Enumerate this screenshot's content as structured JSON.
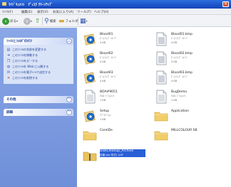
{
  "window": {
    "title": "ﾏｲﾄﾞｷｭﾒﾝﾄ　ﾃﾞｨｽｸ ｸﾘｰﾝｱｯﾌﾟ",
    "close_glyph": "✕"
  },
  "menubar": [
    "ﾌｧｲﾙ(F)",
    "編集(E)",
    "表示(V)",
    "お気に入り(A)",
    "ツール(T)",
    "ヘルプ(H)"
  ],
  "toolbar": {
    "back_label": "戻る",
    "search_label": "検索",
    "folders_label": "フォルダ"
  },
  "left_pane": {
    "tasks_title": "ﾌｧｲﾙとﾌｫﾙﾀﾞのﾀｽｸ",
    "tasks": [
      "このﾌｧｲﾙの名前を変更する",
      "このﾌｧｲﾙを移動する",
      "このﾌｧｲﾙをｺﾋﾟｰする",
      "このﾌｧｲﾙを Web に公開する",
      "このﾌｧｲﾙを電子ﾒｰﾙで送信する",
      "このﾌｧｲﾙを削除する"
    ],
    "other_title": "その他",
    "details_title": "詳細",
    "toggle_glyph": "︽",
    "expand_glyph": "︾"
  },
  "files": [
    {
      "name": "Blood01",
      "desc": "ﾋﾞｯﾄﾏｯﾌﾟ ｲﾒｰｼﾞ",
      "size": "4 KB",
      "icon": "image-file-icon"
    },
    {
      "name": "Blood01.bmp",
      "desc": "ﾋﾞｯﾄﾏｯﾌﾟ ｲﾒｰｼﾞ",
      "size": "4 KB",
      "icon": "bitmap-file-icon"
    },
    {
      "name": "Blood02",
      "desc": "ﾋﾞｯﾄﾏｯﾌﾟ ｲﾒｰｼﾞ",
      "size": "4 KB",
      "icon": "image-file-icon"
    },
    {
      "name": "Blood02.bmp",
      "desc": "ﾋﾞｯﾄﾏｯﾌﾟ ｲﾒｰｼﾞ",
      "size": "4 KB",
      "icon": "bitmap-file-icon"
    },
    {
      "name": "Blood03",
      "desc": "ﾋﾞｯﾄﾏｯﾌﾟ ｲﾒｰｼﾞ",
      "size": "4 KB",
      "icon": "image-file-icon"
    },
    {
      "name": "Blood03.bmp",
      "desc": "ﾋﾞｯﾄﾏｯﾌﾟ ｲﾒｰｼﾞ",
      "size": "4 KB",
      "icon": "bitmap-file-icon"
    },
    {
      "name": "BOA#9051",
      "desc": "ﾃｷｽﾄ ﾄﾞｷｭﾒﾝﾄ",
      "size": "1 KB",
      "icon": "text-file-icon"
    },
    {
      "name": "BugDemo",
      "desc": "ﾃｷｽﾄ ﾄﾞｷｭﾒﾝﾄ",
      "size": "1 KB",
      "icon": "text-file-icon"
    },
    {
      "name": "Setup",
      "desc": "ｱﾌﾟﾘｹｰｼｮﾝ",
      "size": "1 KB",
      "icon": "image-file-icon"
    },
    {
      "name": "Application",
      "desc": "",
      "size": "",
      "icon": "folder-icon"
    },
    {
      "name": "CorelDe",
      "desc": "",
      "size": "",
      "icon": "folder-icon"
    },
    {
      "name": "MILLCOLOUR SB",
      "desc": "",
      "size": "",
      "icon": "folder-icon"
    },
    {
      "name": "DiskCleanup_Archive",
      "desc": "圧縮 (zip 形式) ﾌｫﾙﾀﾞ",
      "size": "",
      "icon": "zip-archive-icon"
    }
  ],
  "colors": {
    "title_bar": "#1c52c8",
    "task_pane": "#7b9be0",
    "selection": "#2a5fd6"
  }
}
